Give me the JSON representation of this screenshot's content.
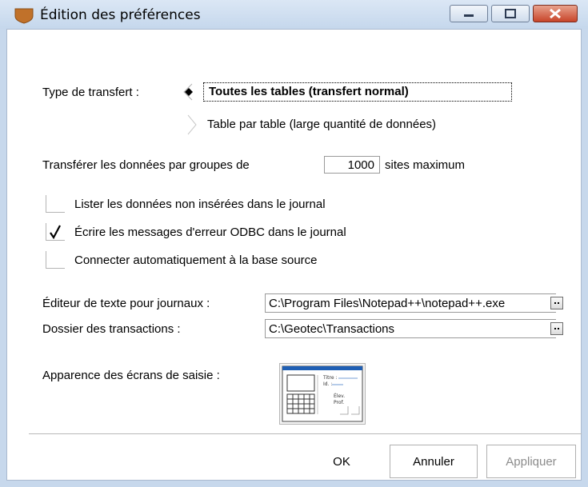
{
  "window": {
    "title": "Édition des préférences"
  },
  "transfer_type": {
    "label": "Type de transfert :",
    "options": [
      {
        "label": "Toutes les tables (transfert normal)",
        "selected": true
      },
      {
        "label": "Table par table (large quantité de données)",
        "selected": false
      }
    ]
  },
  "group_transfer": {
    "prefix": "Transférer les données par groupes de",
    "value": "1000",
    "suffix": "sites maximum"
  },
  "checkboxes": [
    {
      "label": "Lister les données non insérées dans le journal",
      "checked": false
    },
    {
      "label": "Écrire les messages d'erreur ODBC dans le journal",
      "checked": true
    },
    {
      "label": "Connecter automatiquement à la base source",
      "checked": false
    }
  ],
  "log_editor": {
    "label": "Éditeur de texte pour journaux :",
    "value": "C:\\Program Files\\Notepad++\\notepad++.exe"
  },
  "transactions_folder": {
    "label": "Dossier des transactions :",
    "value": "C:\\Geotec\\Transactions"
  },
  "appearance": {
    "label": "Apparence des écrans de saisie :",
    "preview_lines": [
      "Titre :",
      "Id. :",
      "Élev.",
      "Prof."
    ]
  },
  "buttons": {
    "ok": "OK",
    "cancel": "Annuler",
    "apply": "Appliquer"
  },
  "colors": {
    "titlebar": "#c5d7ec",
    "close_button": "#c8452a",
    "app_icon": "#c0712a"
  }
}
